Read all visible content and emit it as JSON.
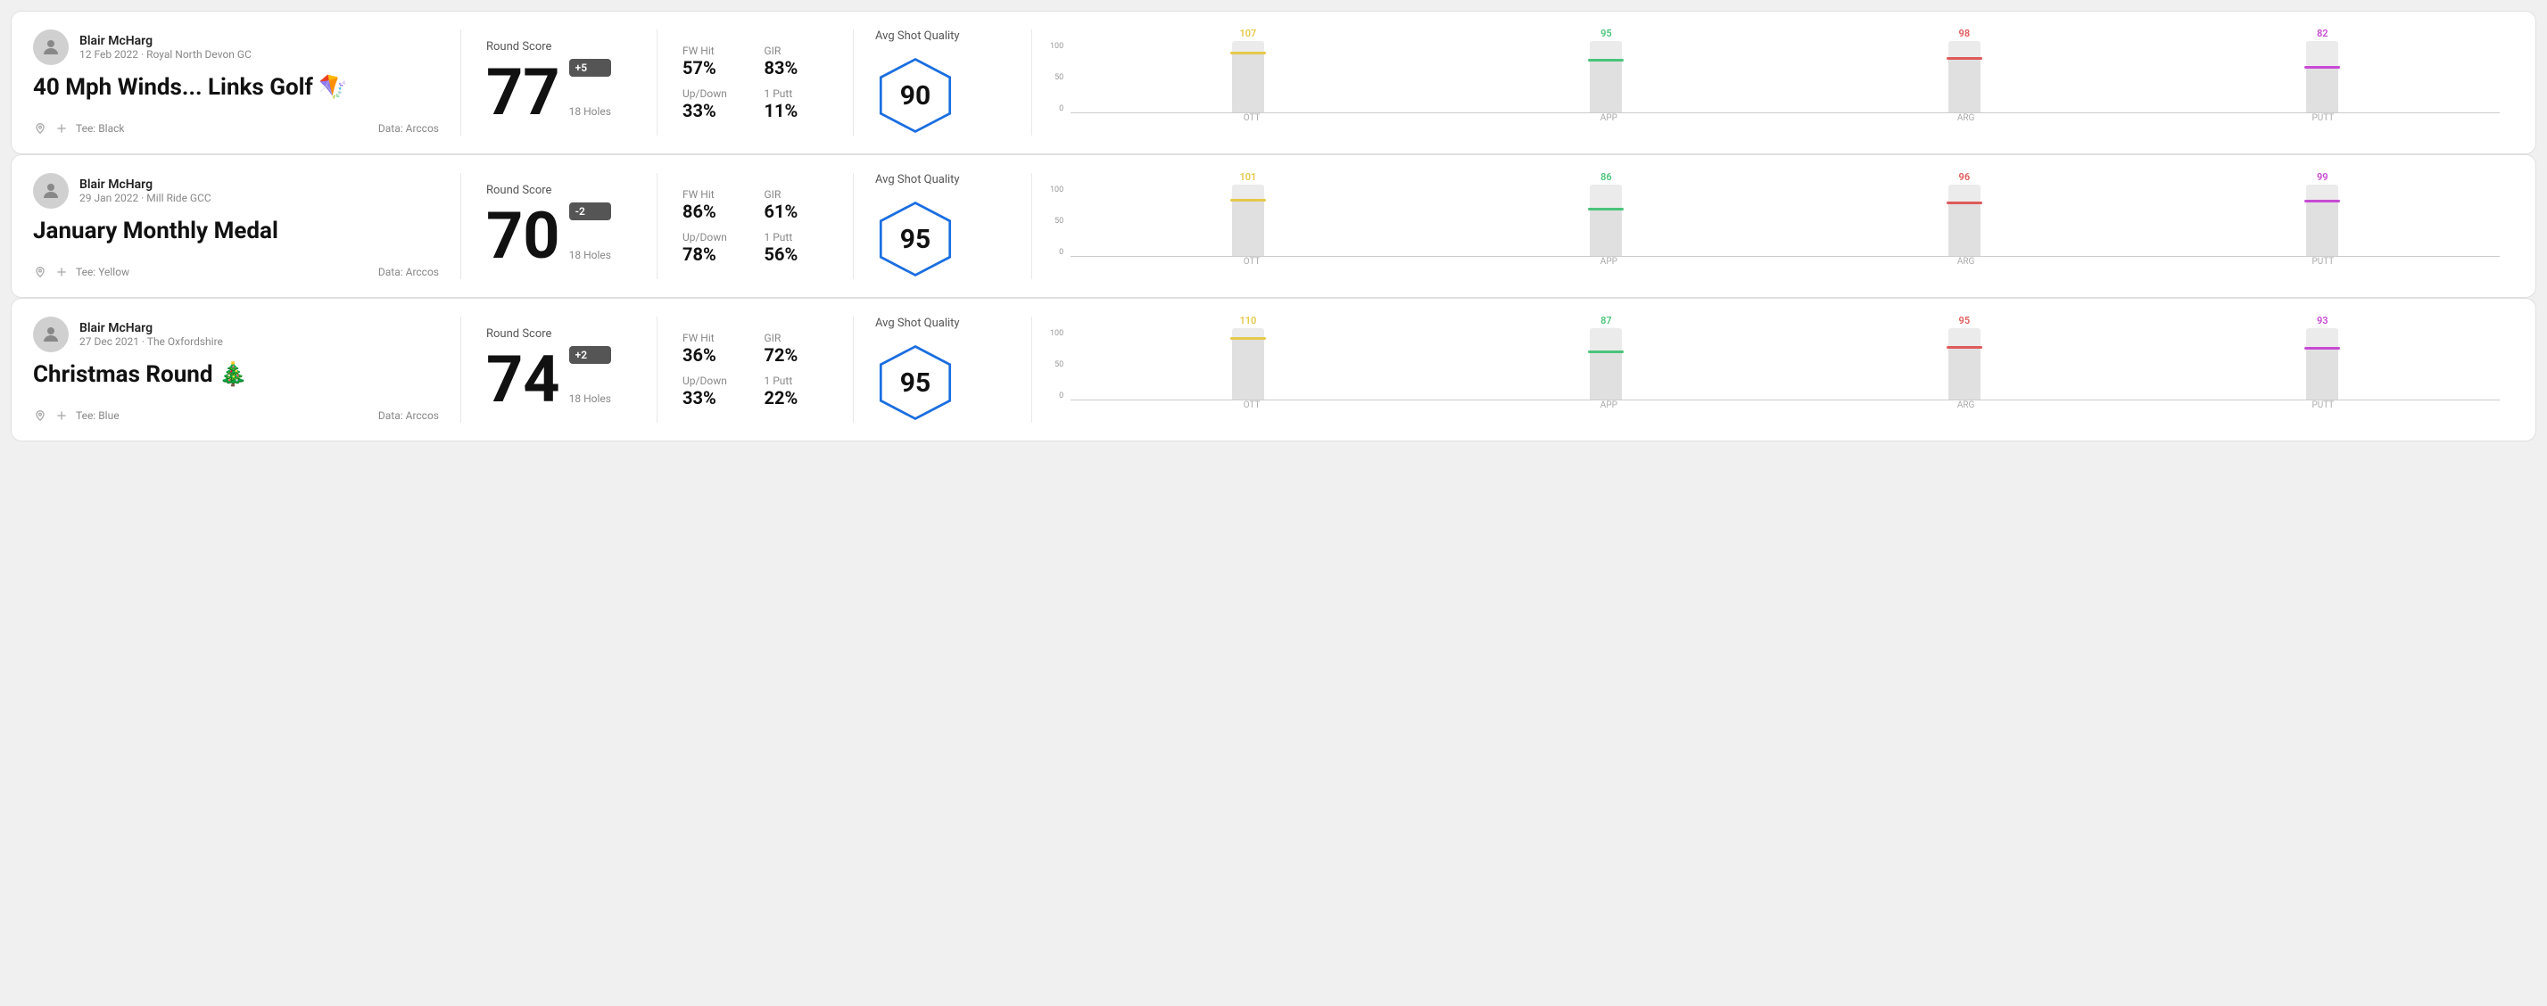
{
  "rounds": [
    {
      "id": "round-1",
      "user": {
        "name": "Blair McHarg",
        "meta": "12 Feb 2022 · Royal North Devon GC"
      },
      "title": "40 Mph Winds... Links Golf 🪁",
      "tee": "Tee: Black",
      "data_source": "Data: Arccos",
      "score": "77",
      "score_badge": "+5",
      "holes": "18 Holes",
      "fw_hit": "57%",
      "gir": "83%",
      "up_down": "33%",
      "one_putt": "11%",
      "avg_quality_label": "Avg Shot Quality",
      "avg_quality_score": "90",
      "chart": {
        "ott": {
          "label": "OTT",
          "value": 107,
          "color": "#e6c84a",
          "pct": 85
        },
        "app": {
          "label": "APP",
          "value": 95,
          "color": "#4ac47a",
          "pct": 75
        },
        "arg": {
          "label": "ARG",
          "value": 98,
          "color": "#e05a5a",
          "pct": 78
        },
        "putt": {
          "label": "PUTT",
          "value": 82,
          "color": "#c84ad4",
          "pct": 65
        }
      }
    },
    {
      "id": "round-2",
      "user": {
        "name": "Blair McHarg",
        "meta": "29 Jan 2022 · Mill Ride GCC"
      },
      "title": "January Monthly Medal",
      "tee": "Tee: Yellow",
      "data_source": "Data: Arccos",
      "score": "70",
      "score_badge": "-2",
      "holes": "18 Holes",
      "fw_hit": "86%",
      "gir": "61%",
      "up_down": "78%",
      "one_putt": "56%",
      "avg_quality_label": "Avg Shot Quality",
      "avg_quality_score": "95",
      "chart": {
        "ott": {
          "label": "OTT",
          "value": 101,
          "color": "#e6c84a",
          "pct": 80
        },
        "app": {
          "label": "APP",
          "value": 86,
          "color": "#4ac47a",
          "pct": 68
        },
        "arg": {
          "label": "ARG",
          "value": 96,
          "color": "#e05a5a",
          "pct": 76
        },
        "putt": {
          "label": "PUTT",
          "value": 99,
          "color": "#c84ad4",
          "pct": 79
        }
      }
    },
    {
      "id": "round-3",
      "user": {
        "name": "Blair McHarg",
        "meta": "27 Dec 2021 · The Oxfordshire"
      },
      "title": "Christmas Round 🎄",
      "tee": "Tee: Blue",
      "data_source": "Data: Arccos",
      "score": "74",
      "score_badge": "+2",
      "holes": "18 Holes",
      "fw_hit": "36%",
      "gir": "72%",
      "up_down": "33%",
      "one_putt": "22%",
      "avg_quality_label": "Avg Shot Quality",
      "avg_quality_score": "95",
      "chart": {
        "ott": {
          "label": "OTT",
          "value": 110,
          "color": "#e6c84a",
          "pct": 88
        },
        "app": {
          "label": "APP",
          "value": 87,
          "color": "#4ac47a",
          "pct": 69
        },
        "arg": {
          "label": "ARG",
          "value": 95,
          "color": "#e05a5a",
          "pct": 75
        },
        "putt": {
          "label": "PUTT",
          "value": 93,
          "color": "#c84ad4",
          "pct": 74
        }
      }
    }
  ],
  "labels": {
    "fw_hit": "FW Hit",
    "gir": "GIR",
    "up_down": "Up/Down",
    "one_putt": "1 Putt",
    "round_score": "Round Score",
    "avg_shot_quality": "Avg Shot Quality",
    "data_arccos": "Data: Arccos",
    "y_axis_100": "100",
    "y_axis_50": "50",
    "y_axis_0": "0"
  }
}
